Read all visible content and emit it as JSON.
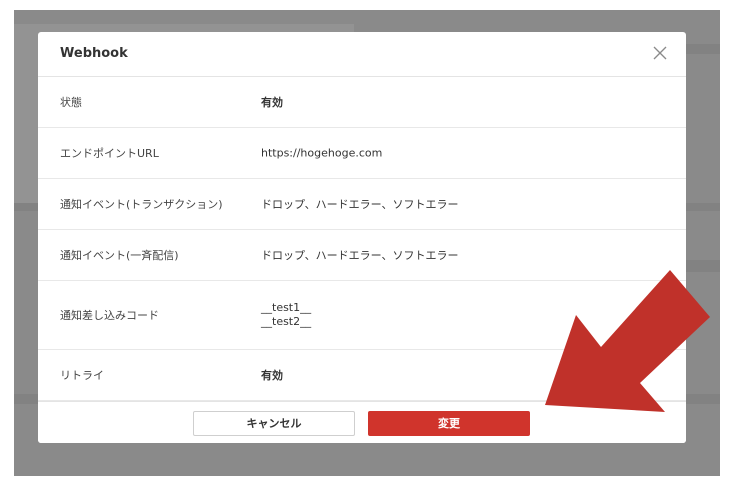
{
  "modal": {
    "title": "Webhook",
    "rows": [
      {
        "label": "状態",
        "value": "有効"
      },
      {
        "label": "エンドポイントURL",
        "value": "https://hogehoge.com"
      },
      {
        "label": "通知イベント(トランザクション)",
        "value": "ドロップ、ハードエラー、ソフトエラー"
      },
      {
        "label": "通知イベント(一斉配信)",
        "value": "ドロップ、ハードエラー、ソフトエラー"
      },
      {
        "label": "通知差し込みコード",
        "values": [
          "__test1__",
          "__test2__"
        ]
      },
      {
        "label": "リトライ",
        "value": "有効"
      }
    ],
    "cancel_label": "キャンセル",
    "ok_label": "変更"
  },
  "colors": {
    "accent": "#d0342c",
    "annotation_arrow": "#c0312a",
    "backdrop": "#8a8a8a"
  },
  "icons": {
    "close": "close-icon",
    "annotation": "arrow-icon"
  }
}
